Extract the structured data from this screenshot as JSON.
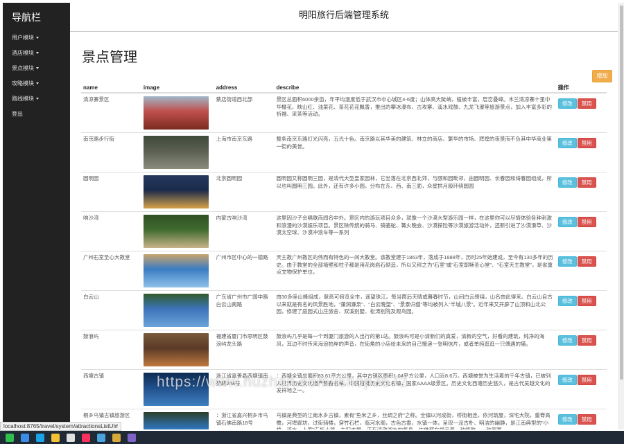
{
  "sidebar": {
    "brand": "导航栏",
    "items": [
      {
        "label": "用户模块",
        "has_caret": true
      },
      {
        "label": "酒店模块",
        "has_caret": true
      },
      {
        "label": "景点模块",
        "has_caret": true
      },
      {
        "label": "攻略模块",
        "has_caret": true
      },
      {
        "label": "路线模块",
        "has_caret": true
      },
      {
        "label": "登出",
        "has_caret": false
      }
    ]
  },
  "header": {
    "title": "明阳旅行后端管理系统"
  },
  "main": {
    "page_title": "景点管理",
    "add_label": "增加",
    "columns": [
      "name",
      "image",
      "address",
      "describe",
      "操作"
    ],
    "edit_label": "修改",
    "ban_label": "禁用",
    "rows": [
      {
        "name": "清凉寨景区",
        "address": "蔡店街道西北部",
        "describe": "景区总面积6000余亩，年平均温度低于武汉市中心城区4-6度；山体高大陡峭，植被丰富，层峦叠嶂。木兰清凉寨十里中华樱花、映山红、油菜花、茶花花花飘香，推出的攀冰瀑布、古攻寨、溪水戏鼓、九龙飞瀑等旅游景点，加入丰富多彩的祈福、采茶等活动。",
        "img_colors": [
          "#c0504d",
          "#7a2b1f",
          "#9fb7c9"
        ]
      },
      {
        "name": "南京路步行街",
        "address": "上海市南京东路",
        "describe": "整条南京东路灯光闪亮，五光十色。南京路以其华美的建筑、林立的商店、繁华的市场、辉煌的夜景而不负其中华商业第一街的美誉。",
        "img_colors": [
          "#5a5f52",
          "#8b8d7d",
          "#3e4a3a"
        ]
      },
      {
        "name": "圆明园",
        "address": "北京圆明园",
        "describe": "圆明园又称圆明三园，是清代大型皇家园林，它坐落在北京西北郊，与颐和园毗邻，由圆明园、长春园和绮春园组成，所以也叫圆明三园。此外，还有许多小园，分布在东、西、南三面，众星拱月般环绕圆园",
        "img_colors": [
          "#1b2a4a",
          "#d8a24a",
          "#263a5e"
        ]
      },
      {
        "name": "响沙湾",
        "address": "内蒙古响沙湾",
        "describe": "这里因沙子会唱歌而闻名中外。景区内的游玩项目众多，就像一个沙漠大型游乐园一样，在这里你可以尽情体验各种刺激和浪漫的沙漠娱乐项目。景区除传统的骑马、骑骆驼、篝火晚会、沙漠探险等沙漠旅游活动外，还新引进了沙漠滑草、沙漠太空球、沙漠冲浪车等一系列",
        "img_colors": [
          "#3f6b2f",
          "#c7b28a",
          "#2f4f24"
        ]
      },
      {
        "name": "广州石室圣心大教堂",
        "address": "广州市区中心的一德路",
        "describe": "天主教广州教区的伟而有特色的一间大教堂。该教堂建于1863年，落成于1888年，历时25年始建成，至今有130多年的历史。由于教堂的全部墙壁和柱子都是用花岗岩石砌造，所以又称之为\"石室\"或\"石室耶稣圣心堂\"、\"石室天主教堂\"，是省重点文物保护单位。",
        "img_colors": [
          "#3b7dc4",
          "#8fc1e8",
          "#c9a46c"
        ]
      },
      {
        "name": "白云山",
        "address": "广东省广州市广园中路白云山南路",
        "describe": "由30多座山峰组成，登高可俯览全市，遥望珠江。每当雨后天晴或暮春时节，山间白云缭绕，山名由此得来。白云山自古以来就是有名的风景胜地，\"蒲涧濂泉\"、\"白云晚望\"、\"景泰归僧\"等均被列入\"羊城八景\"。近年来又开辟了山顶和山北公园，修建了庭园式山庄旅舍、双溪别墅、松涛别院及观鸟园。",
        "img_colors": [
          "#3d73b8",
          "#6aa3d9",
          "#2f5a2c"
        ]
      },
      {
        "name": "鼓浪屿",
        "address": "福建省厦门市思明区鼓浪屿龙头路",
        "describe": "鼓浪屿几乎是每一个到厦门旅游的人出行的第1站。鼓浪屿可是小清新们的真爱，清新的空气，好看的建筑，纯净的海风，耳边不时传来海浪拍岸的声音，在街角的小店给未来的自己慢递一张明信片，或者单纯逛逛一只偶遇的猫。",
        "img_colors": [
          "#5b3a28",
          "#c07a3d",
          "#7a5a3a"
        ]
      },
      {
        "name": "西塘古镇",
        "address": "浙江省嘉善县西塘镇南苑路268号",
        "describe": "：西塘全镇总面积83.61平方公里，其中古镇区面积1.04平方公里，人口近8.6万。西塘被誉为生活着的千年古镇，已被列入世界历史文化遗产预备名单，中国首批历史文化名镇，国家AAAA级景区。历史文化西塘历史悠久，是古代吴越文化的发祥地之一。",
        "img_colors": [
          "#1f4f8a",
          "#3f7fc0",
          "#0e2b52"
        ]
      },
      {
        "name": "桐乡乌镇古镇旅游区",
        "address": "：浙江省嘉兴桐乡市乌镇石佛南路18号",
        "describe": "乌镇是典型的江南水乡古镇，素有\"鱼米之乡，丝绸之府\"之称。全镇以河成街，桥街相连，依河筑屋，深宅大院，重脊高檐，河埠廊坊，过街骑楼，穿竹石栏，临河水阁，古色古香，水镇一体，呈现一派古朴、明洁的幽静，是江南典型的\"小桥、流水、人家\"石板小路，古旧木屋，还有清澈湖水的气息，仿佛都在提示着一种情致，一种氛围。",
        "img_colors": [
          "#2e6fb0",
          "#86b9e2",
          "#2b3f2a"
        ]
      }
    ]
  },
  "status_url": "localhost:8765/travel/system/attractionsListUI#",
  "watermark": "https://www.huzhan.com/ishop3572",
  "colors": {
    "sidebar_bg": "#222222",
    "edit": "#5bc0de",
    "ban": "#d9534f",
    "add": "#f0ad4e"
  }
}
